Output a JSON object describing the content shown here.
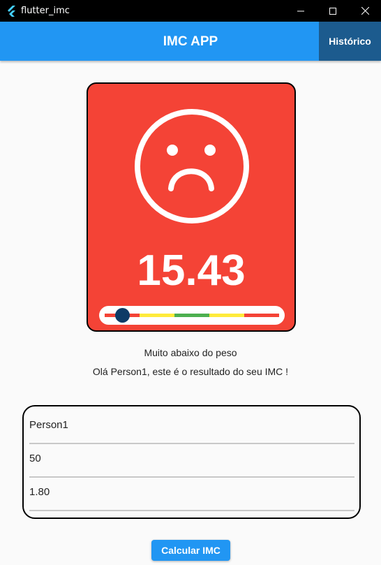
{
  "window": {
    "title": "flutter_imc",
    "app_icon": "flutter-logo-icon"
  },
  "appbar": {
    "title": "IMC APP",
    "history_label": "Histórico"
  },
  "result": {
    "value": "15.43",
    "mood_icon": "sad-face-icon",
    "card_color": "#f44336",
    "scale_colors": [
      "#f44336",
      "#ffeb3b",
      "#4caf50",
      "#ffeb3b",
      "#f44336"
    ],
    "indicator_position": 0.1,
    "category": "Muito abaixo do peso",
    "message": "Olá Person1, este é o resultado do seu IMC !"
  },
  "form": {
    "name": "Person1",
    "weight": "50",
    "height": "1.80"
  },
  "actions": {
    "calculate_label": "Calcular IMC"
  },
  "colors": {
    "primary": "#2196f3",
    "history_button": "#1c5b8e"
  }
}
